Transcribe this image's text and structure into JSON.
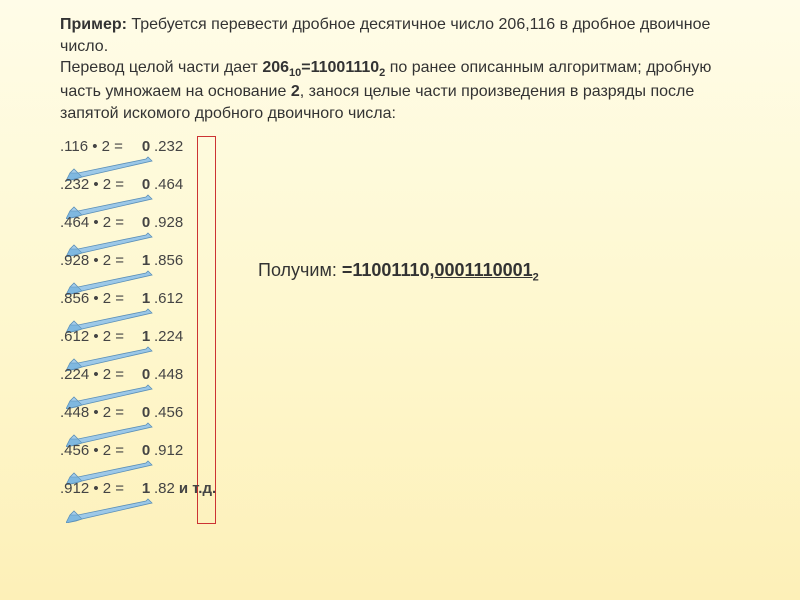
{
  "header": {
    "label_primer": "Пример:",
    "text1": " Требуется перевести дробное десятичное число 206,116 в дробное двоичное число.",
    "text2": "Перевод целой части дает ",
    "int_dec": "206",
    "eq": "=11001110",
    "text3": " по ранее описанным алгоритмам; дробную часть умножаем на основание ",
    "base": "2",
    "text4": ", занося целые части произведения в разряды после запятой искомого дробного двоичного числа:"
  },
  "calc": [
    {
      "left": ".116 • 2 = ",
      "digit": "0",
      "right": ".232"
    },
    {
      "left": ".232 • 2 = ",
      "digit": "0",
      "right": ".464"
    },
    {
      "left": ".464 • 2 = ",
      "digit": "0",
      "right": ".928"
    },
    {
      "left": ".928 • 2 = ",
      "digit": "1",
      "right": ".856"
    },
    {
      "left": ".856 • 2 = ",
      "digit": "1",
      "right": ".612"
    },
    {
      "left": ".612 • 2 = ",
      "digit": "1",
      "right": ".224"
    },
    {
      "left": ".224 • 2 = ",
      "digit": "0",
      "right": ".448"
    },
    {
      "left": ".448 • 2 = ",
      "digit": "0",
      "right": ".456"
    },
    {
      "left": ".456 • 2 = ",
      "digit": "0",
      "right": ".912"
    },
    {
      "left": ".912 • 2 = ",
      "digit": "1",
      "right": ".82"
    }
  ],
  "etc": "  и т.д.",
  "result": {
    "label": "Получим: ",
    "eq": "=11001110,",
    "frac": "0001110001",
    "sub": "2"
  },
  "sub10": "10",
  "sub2": "2"
}
